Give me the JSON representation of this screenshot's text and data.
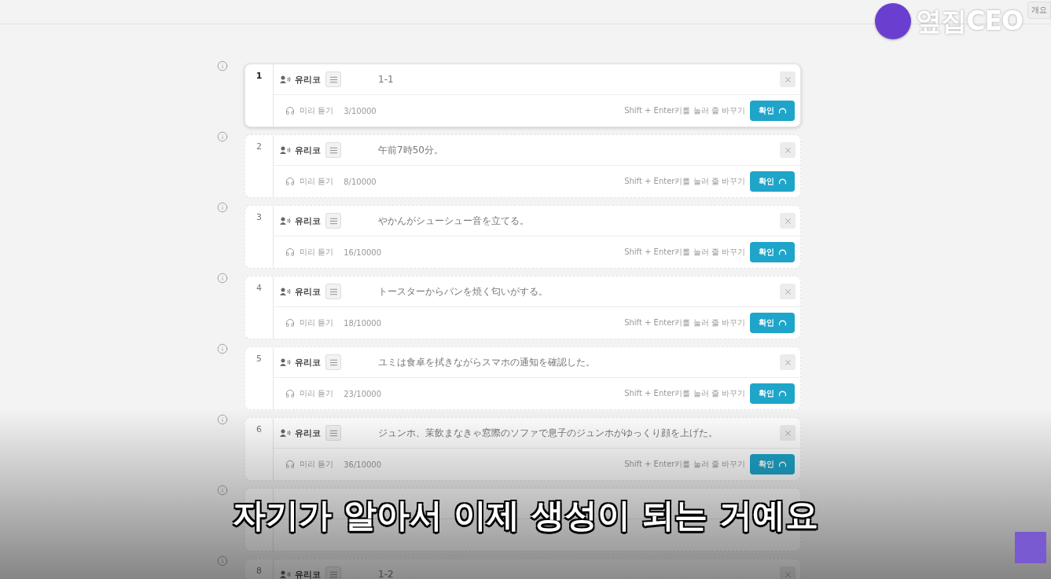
{
  "channel": {
    "name": "옆집CEO",
    "tab_label": "개요"
  },
  "rows": [
    {
      "number": "1",
      "speaker": "유리코",
      "text": "1-1",
      "preview_label": "미리 듣기",
      "count": "3/10000",
      "hint": "Shift + Enter키를 눌러 줄 바꾸기",
      "confirm_label": "확인",
      "selected": true
    },
    {
      "number": "2",
      "speaker": "유리코",
      "text": "午前7時50分。",
      "preview_label": "미리 듣기",
      "count": "8/10000",
      "hint": "Shift + Enter키를 눌러 줄 바꾸기",
      "confirm_label": "확인",
      "selected": false
    },
    {
      "number": "3",
      "speaker": "유리코",
      "text": "やかんがシューシュー音を立てる。",
      "preview_label": "미리 듣기",
      "count": "16/10000",
      "hint": "Shift + Enter키를 눌러 줄 바꾸기",
      "confirm_label": "확인",
      "selected": false
    },
    {
      "number": "4",
      "speaker": "유리코",
      "text": "トースターからパンを焼く匂いがする。",
      "preview_label": "미리 듣기",
      "count": "18/10000",
      "hint": "Shift + Enter키를 눌러 줄 바꾸기",
      "confirm_label": "확인",
      "selected": false
    },
    {
      "number": "5",
      "speaker": "유리코",
      "text": "ユミは食卓を拭きながらスマホの通知を確認した。",
      "preview_label": "미리 듣기",
      "count": "23/10000",
      "hint": "Shift + Enter키를 눌러 줄 바꾸기",
      "confirm_label": "확인",
      "selected": false
    },
    {
      "number": "6",
      "speaker": "유리코",
      "text": "ジュンホ、茉飲まなきゃ窓際のソファで息子のジュンホがゆっくり顔を上げた。",
      "preview_label": "미리 듣기",
      "count": "36/10000",
      "hint": "Shift + Enter키를 눌러 줄 바꾸기",
      "confirm_label": "확인",
      "selected": false
    },
    {
      "selected": false
    },
    {
      "number": "8",
      "speaker": "유리코",
      "text": "1-2",
      "selected": false
    }
  ],
  "subtitle": "자기가 알아서 이제 생성이 되는 거예요"
}
